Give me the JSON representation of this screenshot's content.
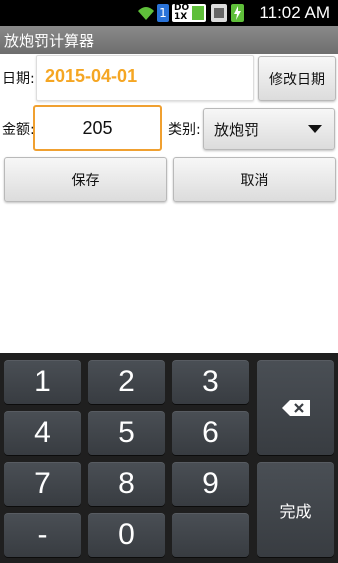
{
  "status_bar": {
    "time": "11:02 AM",
    "icons": [
      "wifi-icon",
      "sim1-icon",
      "data-rate-icon",
      "notification-icon",
      "battery-charging-icon"
    ],
    "sim_label": "1",
    "data_label_top": "DO",
    "data_label_bottom": "1X"
  },
  "app": {
    "title": "放炮罚计算器"
  },
  "form": {
    "date_label": "日期:",
    "date_value": "2015-04-01",
    "change_date_button": "修改日期",
    "amount_label": "金额:",
    "amount_value": "205",
    "category_label": "类别:",
    "category_value": "放炮罚",
    "save_button": "保存",
    "cancel_button": "取消"
  },
  "keyboard": {
    "keys": [
      "1",
      "2",
      "3",
      "4",
      "5",
      "6",
      "7",
      "8",
      "9",
      "-",
      "0",
      ""
    ],
    "backspace_icon": "backspace-icon",
    "done_label": "完成"
  },
  "colors": {
    "accent": "#f5a623",
    "focus_border": "#f0a030",
    "keyboard_bg": "#1f1f1f",
    "key_bg": "#42474d"
  }
}
